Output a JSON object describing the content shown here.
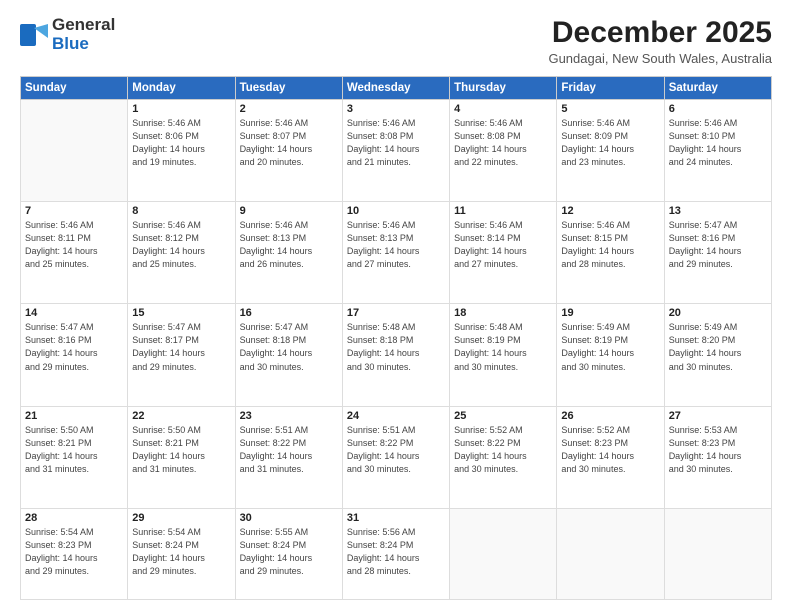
{
  "header": {
    "logo": {
      "general": "General",
      "blue": "Blue"
    },
    "title": "December 2025",
    "subtitle": "Gundagai, New South Wales, Australia"
  },
  "days_of_week": [
    "Sunday",
    "Monday",
    "Tuesday",
    "Wednesday",
    "Thursday",
    "Friday",
    "Saturday"
  ],
  "weeks": [
    [
      {
        "day": "",
        "sunrise": "",
        "sunset": "",
        "daylight": ""
      },
      {
        "day": "1",
        "sunrise": "Sunrise: 5:46 AM",
        "sunset": "Sunset: 8:06 PM",
        "daylight": "Daylight: 14 hours and 19 minutes."
      },
      {
        "day": "2",
        "sunrise": "Sunrise: 5:46 AM",
        "sunset": "Sunset: 8:07 PM",
        "daylight": "Daylight: 14 hours and 20 minutes."
      },
      {
        "day": "3",
        "sunrise": "Sunrise: 5:46 AM",
        "sunset": "Sunset: 8:08 PM",
        "daylight": "Daylight: 14 hours and 21 minutes."
      },
      {
        "day": "4",
        "sunrise": "Sunrise: 5:46 AM",
        "sunset": "Sunset: 8:08 PM",
        "daylight": "Daylight: 14 hours and 22 minutes."
      },
      {
        "day": "5",
        "sunrise": "Sunrise: 5:46 AM",
        "sunset": "Sunset: 8:09 PM",
        "daylight": "Daylight: 14 hours and 23 minutes."
      },
      {
        "day": "6",
        "sunrise": "Sunrise: 5:46 AM",
        "sunset": "Sunset: 8:10 PM",
        "daylight": "Daylight: 14 hours and 24 minutes."
      }
    ],
    [
      {
        "day": "7",
        "sunrise": "Sunrise: 5:46 AM",
        "sunset": "Sunset: 8:11 PM",
        "daylight": "Daylight: 14 hours and 25 minutes."
      },
      {
        "day": "8",
        "sunrise": "Sunrise: 5:46 AM",
        "sunset": "Sunset: 8:12 PM",
        "daylight": "Daylight: 14 hours and 25 minutes."
      },
      {
        "day": "9",
        "sunrise": "Sunrise: 5:46 AM",
        "sunset": "Sunset: 8:13 PM",
        "daylight": "Daylight: 14 hours and 26 minutes."
      },
      {
        "day": "10",
        "sunrise": "Sunrise: 5:46 AM",
        "sunset": "Sunset: 8:13 PM",
        "daylight": "Daylight: 14 hours and 27 minutes."
      },
      {
        "day": "11",
        "sunrise": "Sunrise: 5:46 AM",
        "sunset": "Sunset: 8:14 PM",
        "daylight": "Daylight: 14 hours and 27 minutes."
      },
      {
        "day": "12",
        "sunrise": "Sunrise: 5:46 AM",
        "sunset": "Sunset: 8:15 PM",
        "daylight": "Daylight: 14 hours and 28 minutes."
      },
      {
        "day": "13",
        "sunrise": "Sunrise: 5:47 AM",
        "sunset": "Sunset: 8:16 PM",
        "daylight": "Daylight: 14 hours and 29 minutes."
      }
    ],
    [
      {
        "day": "14",
        "sunrise": "Sunrise: 5:47 AM",
        "sunset": "Sunset: 8:16 PM",
        "daylight": "Daylight: 14 hours and 29 minutes."
      },
      {
        "day": "15",
        "sunrise": "Sunrise: 5:47 AM",
        "sunset": "Sunset: 8:17 PM",
        "daylight": "Daylight: 14 hours and 29 minutes."
      },
      {
        "day": "16",
        "sunrise": "Sunrise: 5:47 AM",
        "sunset": "Sunset: 8:18 PM",
        "daylight": "Daylight: 14 hours and 30 minutes."
      },
      {
        "day": "17",
        "sunrise": "Sunrise: 5:48 AM",
        "sunset": "Sunset: 8:18 PM",
        "daylight": "Daylight: 14 hours and 30 minutes."
      },
      {
        "day": "18",
        "sunrise": "Sunrise: 5:48 AM",
        "sunset": "Sunset: 8:19 PM",
        "daylight": "Daylight: 14 hours and 30 minutes."
      },
      {
        "day": "19",
        "sunrise": "Sunrise: 5:49 AM",
        "sunset": "Sunset: 8:19 PM",
        "daylight": "Daylight: 14 hours and 30 minutes."
      },
      {
        "day": "20",
        "sunrise": "Sunrise: 5:49 AM",
        "sunset": "Sunset: 8:20 PM",
        "daylight": "Daylight: 14 hours and 30 minutes."
      }
    ],
    [
      {
        "day": "21",
        "sunrise": "Sunrise: 5:50 AM",
        "sunset": "Sunset: 8:21 PM",
        "daylight": "Daylight: 14 hours and 31 minutes."
      },
      {
        "day": "22",
        "sunrise": "Sunrise: 5:50 AM",
        "sunset": "Sunset: 8:21 PM",
        "daylight": "Daylight: 14 hours and 31 minutes."
      },
      {
        "day": "23",
        "sunrise": "Sunrise: 5:51 AM",
        "sunset": "Sunset: 8:22 PM",
        "daylight": "Daylight: 14 hours and 31 minutes."
      },
      {
        "day": "24",
        "sunrise": "Sunrise: 5:51 AM",
        "sunset": "Sunset: 8:22 PM",
        "daylight": "Daylight: 14 hours and 30 minutes."
      },
      {
        "day": "25",
        "sunrise": "Sunrise: 5:52 AM",
        "sunset": "Sunset: 8:22 PM",
        "daylight": "Daylight: 14 hours and 30 minutes."
      },
      {
        "day": "26",
        "sunrise": "Sunrise: 5:52 AM",
        "sunset": "Sunset: 8:23 PM",
        "daylight": "Daylight: 14 hours and 30 minutes."
      },
      {
        "day": "27",
        "sunrise": "Sunrise: 5:53 AM",
        "sunset": "Sunset: 8:23 PM",
        "daylight": "Daylight: 14 hours and 30 minutes."
      }
    ],
    [
      {
        "day": "28",
        "sunrise": "Sunrise: 5:54 AM",
        "sunset": "Sunset: 8:23 PM",
        "daylight": "Daylight: 14 hours and 29 minutes."
      },
      {
        "day": "29",
        "sunrise": "Sunrise: 5:54 AM",
        "sunset": "Sunset: 8:24 PM",
        "daylight": "Daylight: 14 hours and 29 minutes."
      },
      {
        "day": "30",
        "sunrise": "Sunrise: 5:55 AM",
        "sunset": "Sunset: 8:24 PM",
        "daylight": "Daylight: 14 hours and 29 minutes."
      },
      {
        "day": "31",
        "sunrise": "Sunrise: 5:56 AM",
        "sunset": "Sunset: 8:24 PM",
        "daylight": "Daylight: 14 hours and 28 minutes."
      },
      {
        "day": "",
        "sunrise": "",
        "sunset": "",
        "daylight": ""
      },
      {
        "day": "",
        "sunrise": "",
        "sunset": "",
        "daylight": ""
      },
      {
        "day": "",
        "sunrise": "",
        "sunset": "",
        "daylight": ""
      }
    ]
  ]
}
